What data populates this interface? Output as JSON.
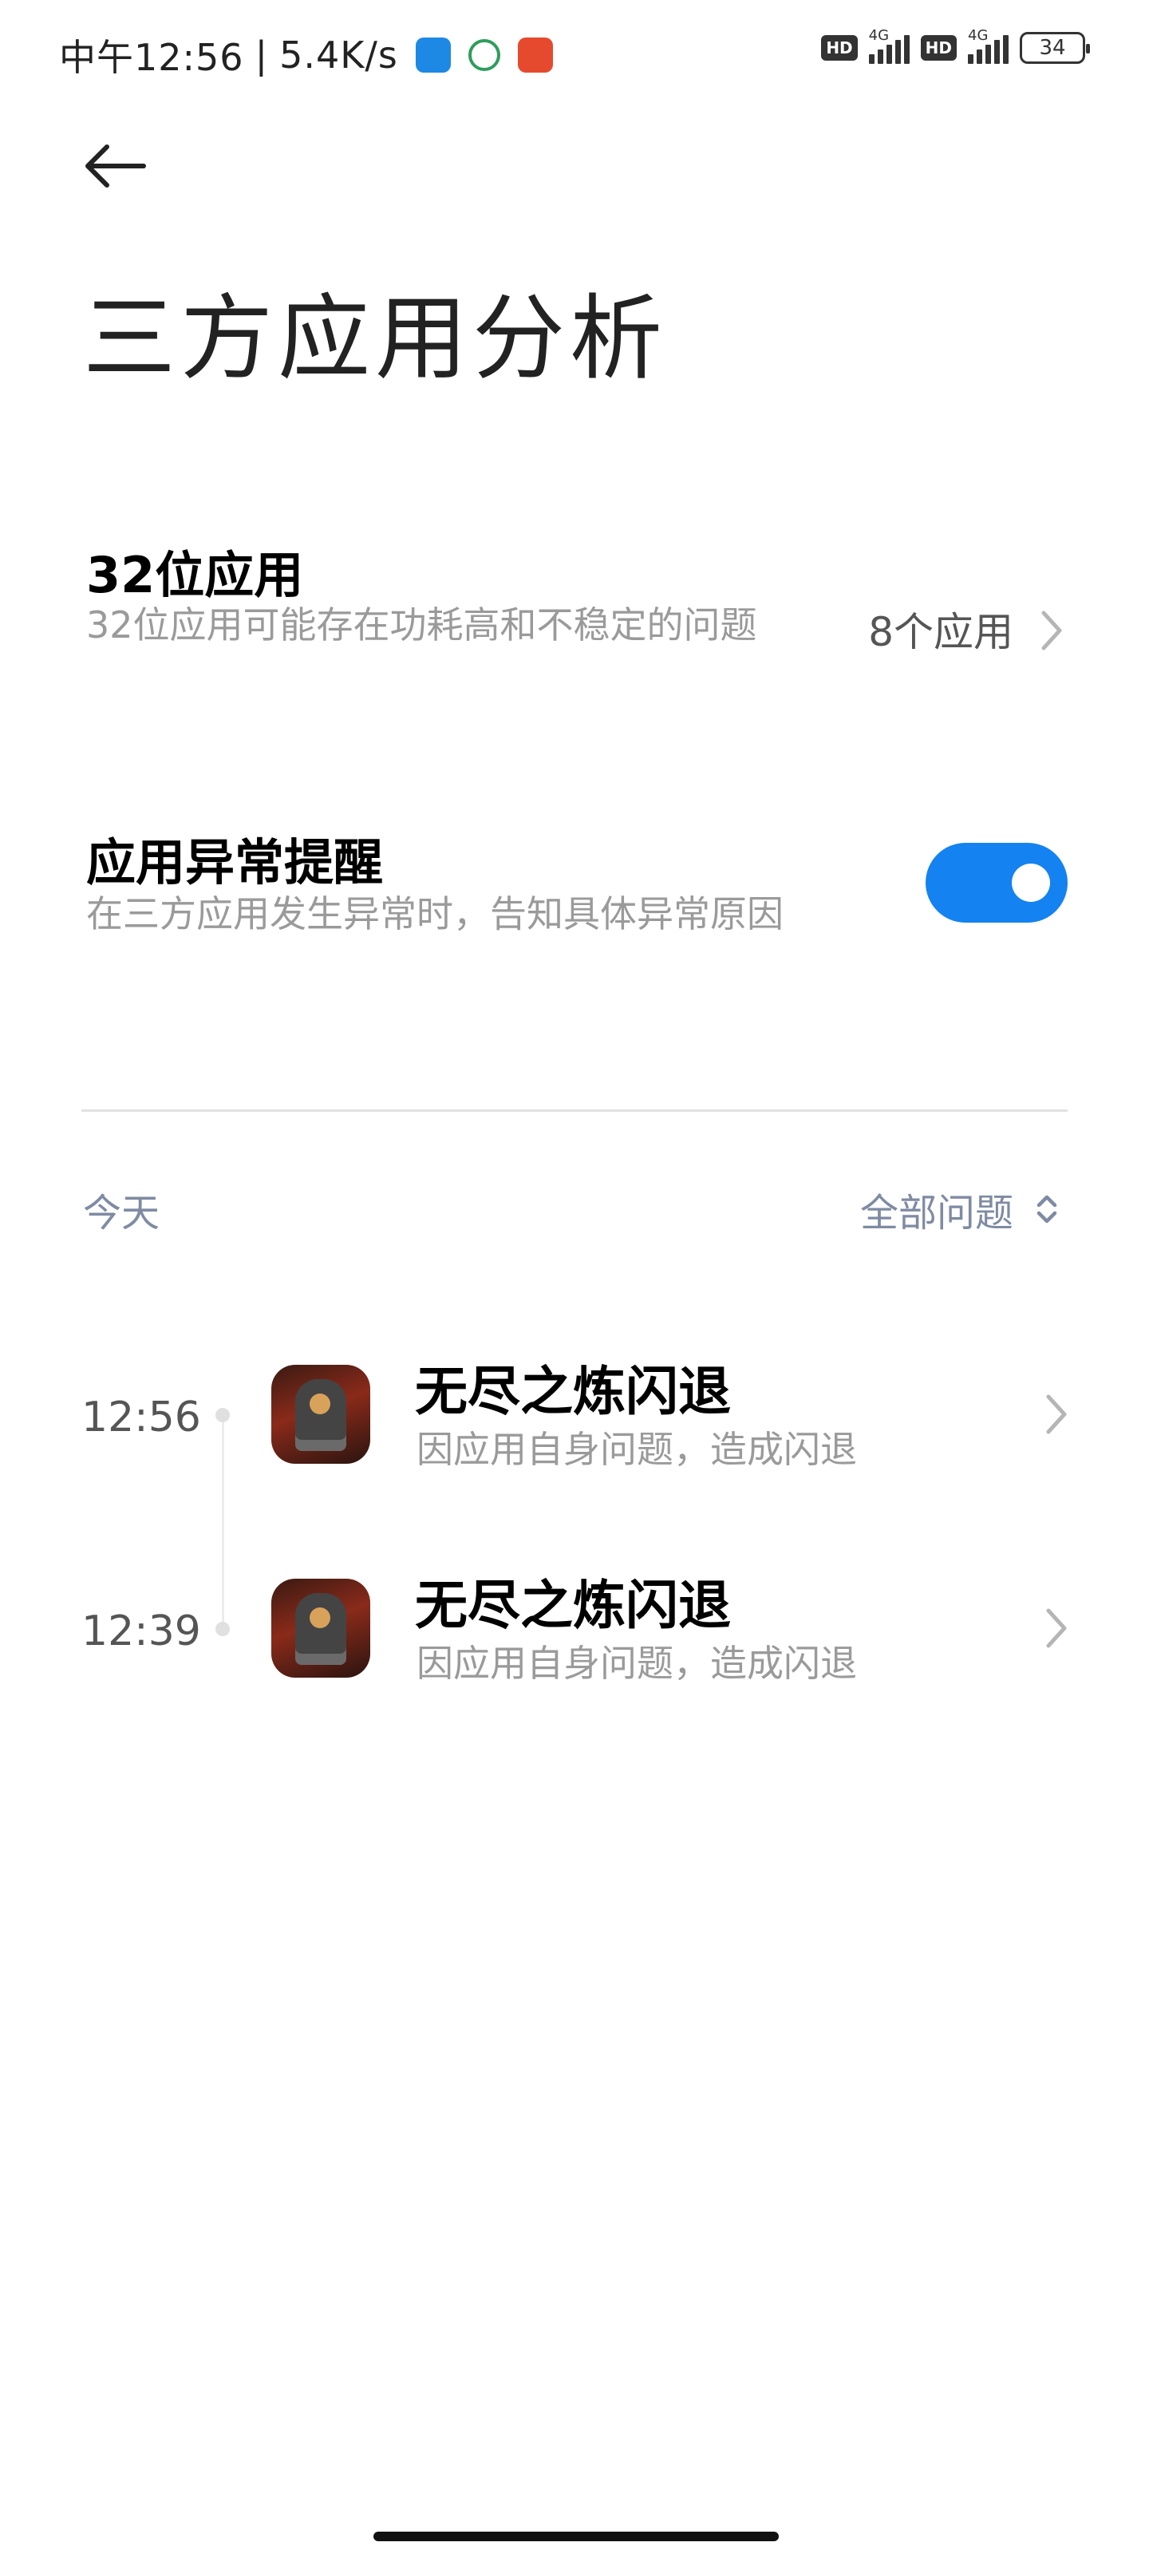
{
  "status_bar": {
    "time": "中午12:56",
    "separator": "|",
    "network_speed": "5.4K/s",
    "hd_label": "HD",
    "signal_type": "4G",
    "battery": "34",
    "notification_icons": [
      "blue-app-icon",
      "green-app-icon",
      "red-app-icon"
    ]
  },
  "header": {
    "back_icon": "arrow-left-icon",
    "title": "三方应用分析"
  },
  "settings": {
    "apps_32bit": {
      "title": "32位应用",
      "description": "32位应用可能存在功耗高和不稳定的问题",
      "value": "8个应用"
    },
    "abnormal_alert": {
      "title": "应用异常提醒",
      "description": "在三方应用发生异常时，告知具体异常原因",
      "enabled": true
    }
  },
  "timeline": {
    "day_label": "今天",
    "filter_label": "全部问题",
    "events": [
      {
        "time": "12:56",
        "title": "无尽之炼闪退",
        "description": "因应用自身问题，造成闪退"
      },
      {
        "time": "12:39",
        "title": "无尽之炼闪退",
        "description": "因应用自身问题，造成闪退"
      }
    ]
  },
  "colors": {
    "accent": "#1482f0",
    "secondary_text": "#9a9a9a",
    "timeline_header": "#7f8ba3"
  }
}
